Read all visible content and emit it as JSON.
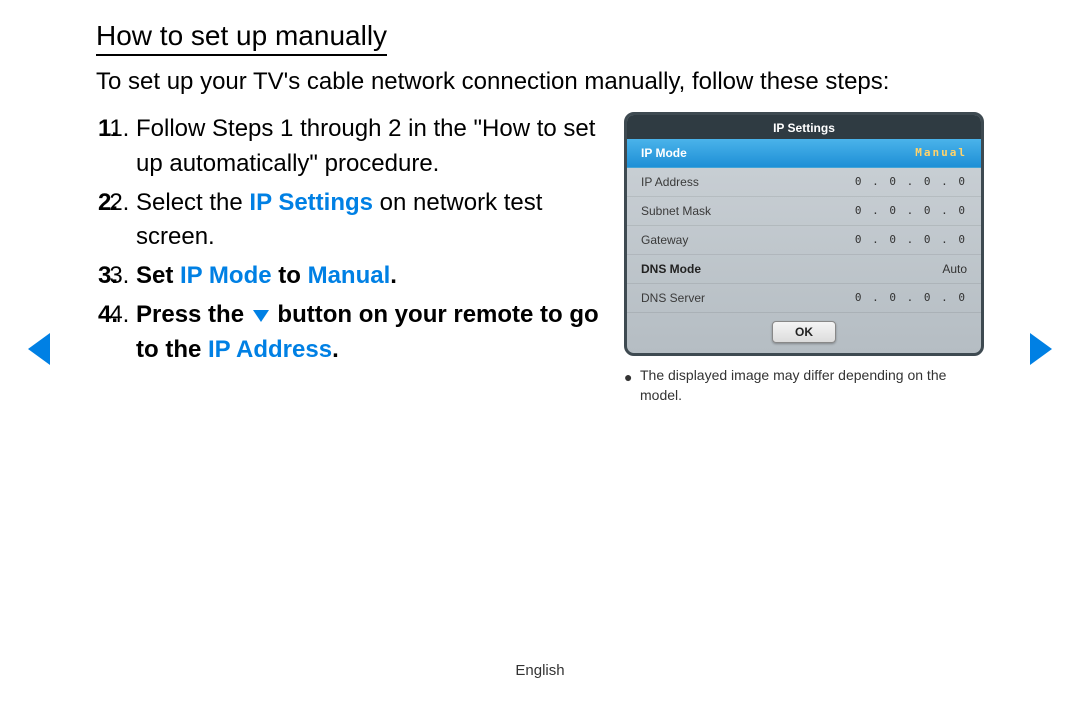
{
  "title": "How to set up manually",
  "intro": "To set up your TV's cable network connection manually, follow these steps:",
  "steps": [
    {
      "num": "1.",
      "parts": [
        {
          "t": "Follow Steps 1 through 2 in the \"How to set up automatically\" procedure."
        }
      ]
    },
    {
      "num": "2.",
      "parts": [
        {
          "t": "Select the "
        },
        {
          "t": "IP Settings",
          "style": "blue"
        },
        {
          "t": " on network test screen."
        }
      ]
    },
    {
      "num": "3.",
      "bold": true,
      "parts": [
        {
          "t": "Set "
        },
        {
          "t": "IP Mode",
          "style": "blue"
        },
        {
          "t": " to "
        },
        {
          "t": "Manual",
          "style": "blue"
        },
        {
          "t": "."
        }
      ]
    },
    {
      "num": "4.",
      "bold": true,
      "parts": [
        {
          "t": "Press the "
        },
        {
          "icon": "down"
        },
        {
          "t": " button on your remote to go to the "
        },
        {
          "t": "IP Address",
          "style": "blue"
        },
        {
          "t": "."
        }
      ]
    }
  ],
  "panel": {
    "title": "IP Settings",
    "highlight": {
      "label": "IP Mode",
      "value": "Manual"
    },
    "rows": [
      {
        "label": "IP Address",
        "value": "0 . 0 . 0 . 0"
      },
      {
        "label": "Subnet Mask",
        "value": "0 . 0 . 0 . 0"
      },
      {
        "label": "Gateway",
        "value": "0 . 0 . 0 . 0"
      }
    ],
    "dns_mode": {
      "label": "DNS Mode",
      "value": "Auto"
    },
    "dns_server": {
      "label": "DNS Server",
      "value": "0 . 0 . 0 . 0"
    },
    "ok": "OK"
  },
  "note": "The displayed image may differ depending on the model.",
  "footer": "English"
}
